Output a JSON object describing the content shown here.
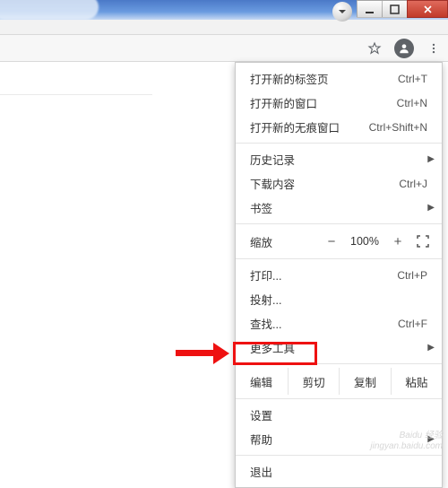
{
  "menu": {
    "new_tab": "打开新的标签页",
    "new_tab_sc": "Ctrl+T",
    "new_window": "打开新的窗口",
    "new_window_sc": "Ctrl+N",
    "incognito": "打开新的无痕窗口",
    "incognito_sc": "Ctrl+Shift+N",
    "history": "历史记录",
    "downloads": "下载内容",
    "downloads_sc": "Ctrl+J",
    "bookmarks": "书签",
    "zoom_label": "缩放",
    "zoom_value": "100%",
    "print": "打印...",
    "print_sc": "Ctrl+P",
    "cast": "投射...",
    "find": "查找...",
    "find_sc": "Ctrl+F",
    "more_tools": "更多工具",
    "edit_label": "编辑",
    "cut": "剪切",
    "copy": "复制",
    "paste": "粘贴",
    "settings": "设置",
    "help": "帮助",
    "exit": "退出"
  },
  "watermark": {
    "l1": "Baidu 经验",
    "l2": "jingyan.baidu.com"
  }
}
